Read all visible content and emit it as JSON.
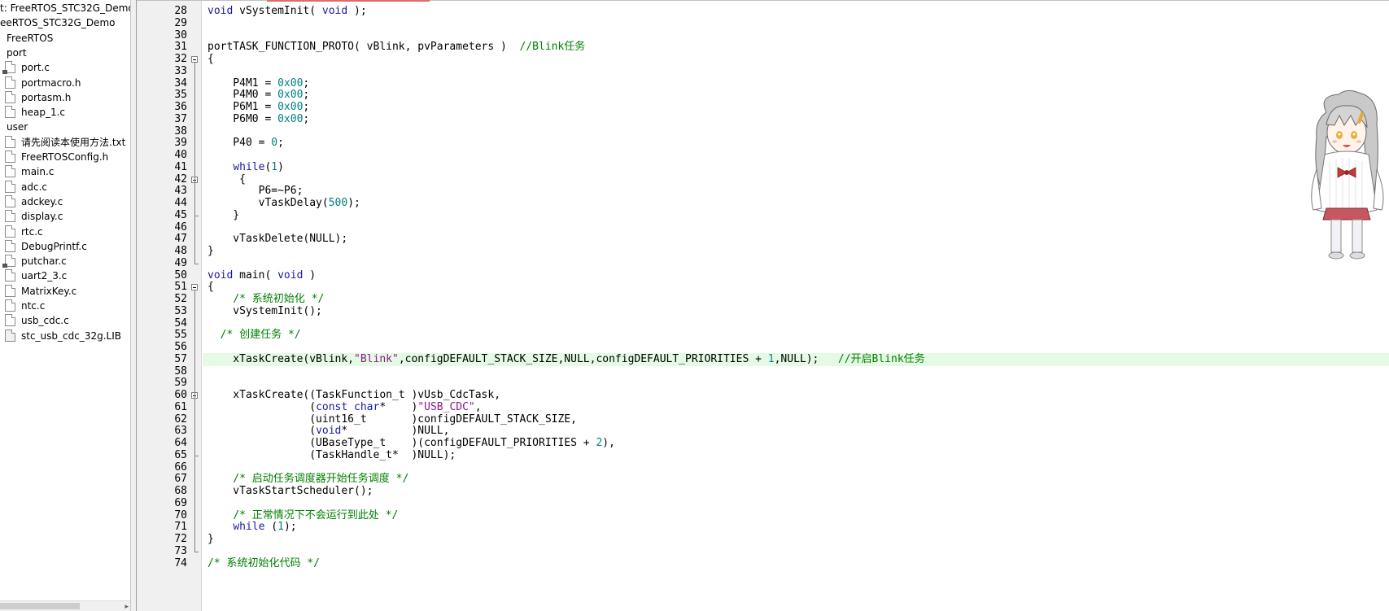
{
  "project_tree": {
    "items": [
      {
        "label": "t: FreeRTOS_STC32G_Demo",
        "icon": "none",
        "indent": 0
      },
      {
        "label": "eeRTOS_STC32G_Demo",
        "icon": "none",
        "indent": 0
      },
      {
        "label": "FreeRTOS",
        "icon": "none",
        "indent": 8
      },
      {
        "label": "port",
        "icon": "none",
        "indent": 8
      },
      {
        "label": "port.c",
        "icon": "file-lock-icon",
        "indent": 6
      },
      {
        "label": "portmacro.h",
        "icon": "file-icon",
        "indent": 6
      },
      {
        "label": "portasm.h",
        "icon": "file-icon",
        "indent": 6
      },
      {
        "label": "heap_1.c",
        "icon": "file-icon",
        "indent": 6
      },
      {
        "label": "user",
        "icon": "none",
        "indent": 8
      },
      {
        "label": "请先阅读本使用方法.txt",
        "icon": "file-icon",
        "indent": 6
      },
      {
        "label": "FreeRTOSConfig.h",
        "icon": "file-icon",
        "indent": 6
      },
      {
        "label": "main.c",
        "icon": "file-icon",
        "indent": 6
      },
      {
        "label": "adc.c",
        "icon": "file-icon",
        "indent": 6
      },
      {
        "label": "adckey.c",
        "icon": "file-icon",
        "indent": 6
      },
      {
        "label": "display.c",
        "icon": "file-icon",
        "indent": 6
      },
      {
        "label": "rtc.c",
        "icon": "file-icon",
        "indent": 6
      },
      {
        "label": "DebugPrintf.c",
        "icon": "file-icon",
        "indent": 6
      },
      {
        "label": "putchar.c",
        "icon": "file-lock-icon",
        "indent": 6
      },
      {
        "label": "uart2_3.c",
        "icon": "file-icon",
        "indent": 6
      },
      {
        "label": "MatrixKey.c",
        "icon": "file-icon",
        "indent": 6
      },
      {
        "label": "ntc.c",
        "icon": "file-icon",
        "indent": 6
      },
      {
        "label": "usb_cdc.c",
        "icon": "file-icon",
        "indent": 6
      },
      {
        "label": "stc_usb_cdc_32g.LIB",
        "icon": "lib-file-icon",
        "indent": 6
      }
    ],
    "hscroll_arrow": "▸"
  },
  "editor": {
    "highlighted_line": 57,
    "lines": [
      {
        "n": "28",
        "fold": "",
        "parts": [
          {
            "t": "void",
            "c": "kw"
          },
          {
            "t": " vSystemInit( ",
            "c": ""
          },
          {
            "t": "void",
            "c": "kw"
          },
          {
            "t": " );",
            "c": ""
          }
        ]
      },
      {
        "n": "29",
        "fold": "",
        "parts": []
      },
      {
        "n": "30",
        "fold": "",
        "parts": []
      },
      {
        "n": "31",
        "fold": "",
        "parts": [
          {
            "t": "portTASK_FUNCTION_PROTO( vBlink, pvParameters )  ",
            "c": ""
          },
          {
            "t": "//Blink任务",
            "c": "cmt"
          }
        ]
      },
      {
        "n": "32",
        "fold": "open",
        "parts": [
          {
            "t": "{",
            "c": ""
          }
        ]
      },
      {
        "n": "33",
        "fold": "",
        "parts": []
      },
      {
        "n": "34",
        "fold": "",
        "parts": [
          {
            "t": "    P4M1 = ",
            "c": ""
          },
          {
            "t": "0x00",
            "c": "num"
          },
          {
            "t": ";",
            "c": ""
          }
        ]
      },
      {
        "n": "35",
        "fold": "",
        "parts": [
          {
            "t": "    P4M0 = ",
            "c": ""
          },
          {
            "t": "0x00",
            "c": "num"
          },
          {
            "t": ";",
            "c": ""
          }
        ]
      },
      {
        "n": "36",
        "fold": "",
        "parts": [
          {
            "t": "    P6M1 = ",
            "c": ""
          },
          {
            "t": "0x00",
            "c": "num"
          },
          {
            "t": ";",
            "c": ""
          }
        ]
      },
      {
        "n": "37",
        "fold": "",
        "parts": [
          {
            "t": "    P6M0 = ",
            "c": ""
          },
          {
            "t": "0x00",
            "c": "num"
          },
          {
            "t": ";",
            "c": ""
          }
        ]
      },
      {
        "n": "38",
        "fold": "",
        "parts": []
      },
      {
        "n": "39",
        "fold": "",
        "parts": [
          {
            "t": "    P40 = ",
            "c": ""
          },
          {
            "t": "0",
            "c": "num"
          },
          {
            "t": ";",
            "c": ""
          }
        ]
      },
      {
        "n": "40",
        "fold": "",
        "parts": []
      },
      {
        "n": "41",
        "fold": "",
        "parts": [
          {
            "t": "    ",
            "c": ""
          },
          {
            "t": "while",
            "c": "kw"
          },
          {
            "t": "(",
            "c": ""
          },
          {
            "t": "1",
            "c": "num"
          },
          {
            "t": ")",
            "c": ""
          }
        ]
      },
      {
        "n": "42",
        "fold": "open",
        "parts": [
          {
            "t": "     {",
            "c": ""
          }
        ]
      },
      {
        "n": "43",
        "fold": "",
        "parts": [
          {
            "t": "        P6=~P6;",
            "c": ""
          }
        ]
      },
      {
        "n": "44",
        "fold": "",
        "parts": [
          {
            "t": "        vTaskDelay(",
            "c": ""
          },
          {
            "t": "500",
            "c": "num"
          },
          {
            "t": ");",
            "c": ""
          }
        ]
      },
      {
        "n": "45",
        "fold": "end",
        "parts": [
          {
            "t": "    }",
            "c": ""
          }
        ]
      },
      {
        "n": "46",
        "fold": "",
        "parts": []
      },
      {
        "n": "47",
        "fold": "",
        "parts": [
          {
            "t": "    vTaskDelete(NULL);",
            "c": ""
          }
        ]
      },
      {
        "n": "48",
        "fold": "",
        "parts": [
          {
            "t": "}",
            "c": ""
          }
        ]
      },
      {
        "n": "49",
        "fold": "end",
        "parts": []
      },
      {
        "n": "50",
        "fold": "",
        "parts": [
          {
            "t": "void",
            "c": "kw"
          },
          {
            "t": " main( ",
            "c": ""
          },
          {
            "t": "void",
            "c": "kw"
          },
          {
            "t": " )",
            "c": ""
          }
        ]
      },
      {
        "n": "51",
        "fold": "open",
        "parts": [
          {
            "t": "{",
            "c": ""
          }
        ]
      },
      {
        "n": "52",
        "fold": "",
        "parts": [
          {
            "t": "    ",
            "c": ""
          },
          {
            "t": "/* 系统初始化 */",
            "c": "cmt"
          }
        ]
      },
      {
        "n": "53",
        "fold": "",
        "parts": [
          {
            "t": "    vSystemInit();",
            "c": ""
          }
        ]
      },
      {
        "n": "54",
        "fold": "",
        "parts": []
      },
      {
        "n": "55",
        "fold": "",
        "parts": [
          {
            "t": "  ",
            "c": ""
          },
          {
            "t": "/* 创建任务 */",
            "c": "cmt"
          }
        ]
      },
      {
        "n": "56",
        "fold": "",
        "parts": []
      },
      {
        "n": "57",
        "fold": "",
        "parts": [
          {
            "t": "    xTaskCreate(vBlink,",
            "c": ""
          },
          {
            "t": "\"Blink\"",
            "c": "str"
          },
          {
            "t": ",configDEFAULT_STACK_SIZE,NULL,configDEFAULT_PRIORITIES + ",
            "c": ""
          },
          {
            "t": "1",
            "c": "num"
          },
          {
            "t": ",NULL);   ",
            "c": ""
          },
          {
            "t": "//开启Blink任务",
            "c": "cmt"
          }
        ]
      },
      {
        "n": "58",
        "fold": "",
        "parts": []
      },
      {
        "n": "59",
        "fold": "",
        "parts": []
      },
      {
        "n": "60",
        "fold": "open",
        "parts": [
          {
            "t": "    xTaskCreate((TaskFunction_t )vUsb_CdcTask,",
            "c": ""
          }
        ]
      },
      {
        "n": "61",
        "fold": "",
        "parts": [
          {
            "t": "                (",
            "c": ""
          },
          {
            "t": "const char",
            "c": "kw"
          },
          {
            "t": "*    )",
            "c": ""
          },
          {
            "t": "\"USB_CDC\"",
            "c": "str"
          },
          {
            "t": ",",
            "c": ""
          }
        ]
      },
      {
        "n": "62",
        "fold": "",
        "parts": [
          {
            "t": "                (uint16_t       )configDEFAULT_STACK_SIZE,",
            "c": ""
          }
        ]
      },
      {
        "n": "63",
        "fold": "",
        "parts": [
          {
            "t": "                (",
            "c": ""
          },
          {
            "t": "void",
            "c": "kw"
          },
          {
            "t": "*          )NULL,",
            "c": ""
          }
        ]
      },
      {
        "n": "64",
        "fold": "",
        "parts": [
          {
            "t": "                (UBaseType_t    )(configDEFAULT_PRIORITIES + ",
            "c": ""
          },
          {
            "t": "2",
            "c": "num"
          },
          {
            "t": "),",
            "c": ""
          }
        ]
      },
      {
        "n": "65",
        "fold": "end",
        "parts": [
          {
            "t": "                (TaskHandle_t*  )NULL);",
            "c": ""
          }
        ]
      },
      {
        "n": "66",
        "fold": "",
        "parts": []
      },
      {
        "n": "67",
        "fold": "",
        "parts": [
          {
            "t": "    ",
            "c": ""
          },
          {
            "t": "/* 启动任务调度器开始任务调度 */",
            "c": "cmt"
          }
        ]
      },
      {
        "n": "68",
        "fold": "",
        "parts": [
          {
            "t": "    vTaskStartScheduler();",
            "c": ""
          }
        ]
      },
      {
        "n": "69",
        "fold": "",
        "parts": []
      },
      {
        "n": "70",
        "fold": "",
        "parts": [
          {
            "t": "    ",
            "c": ""
          },
          {
            "t": "/* 正常情况下不会运行到此处 */",
            "c": "cmt"
          }
        ]
      },
      {
        "n": "71",
        "fold": "",
        "parts": [
          {
            "t": "    ",
            "c": ""
          },
          {
            "t": "while",
            "c": "kw"
          },
          {
            "t": " (",
            "c": ""
          },
          {
            "t": "1",
            "c": "num"
          },
          {
            "t": ");",
            "c": ""
          }
        ]
      },
      {
        "n": "72",
        "fold": "",
        "parts": [
          {
            "t": "}",
            "c": ""
          }
        ]
      },
      {
        "n": "73",
        "fold": "end",
        "parts": []
      },
      {
        "n": "74",
        "fold": "",
        "parts": [
          {
            "t": "/* 系统初始化代码 */",
            "c": "cmt"
          }
        ]
      }
    ]
  },
  "colors": {
    "keyword": "#1a1aa6",
    "number": "#008080",
    "string": "#8b1a8b",
    "comment": "#008000",
    "current_line": "#e4fae4",
    "gutter": "#f0f0f0"
  },
  "mascot": {
    "description_icon": "anime-girl-mascot-icon"
  }
}
